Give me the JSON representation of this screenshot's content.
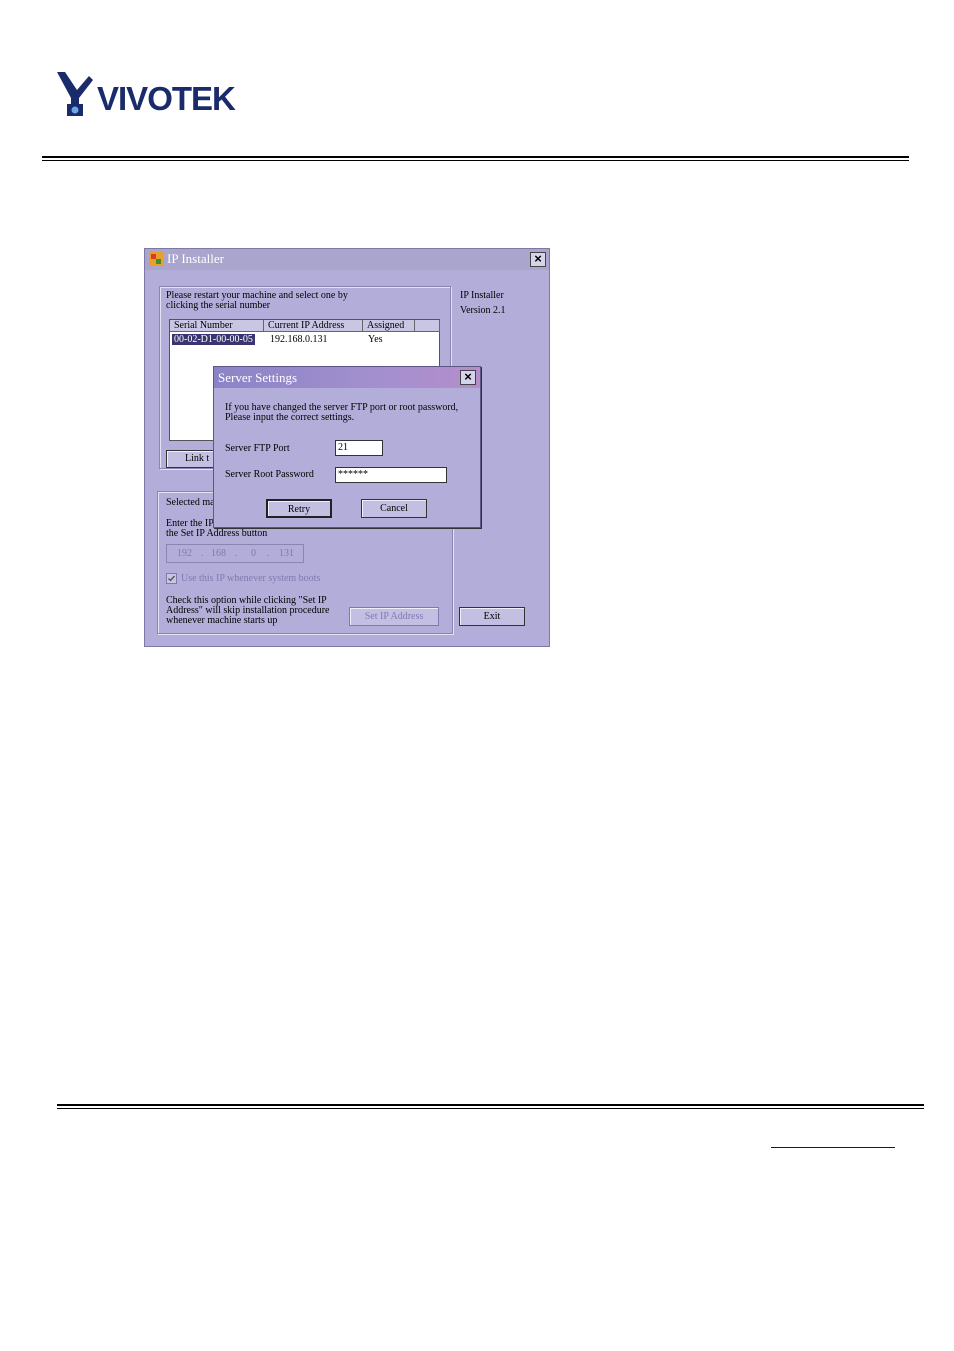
{
  "logo": {
    "brand": "VIVOTEK"
  },
  "colors": {
    "window_bg": "#b3aed9",
    "dialog_title": "#9488c9",
    "brand": "#1a2b6b",
    "link": "#0000ee"
  },
  "installer": {
    "title": "IP Installer",
    "instruction_line1": "Please restart your machine and select one by",
    "instruction_line2": "clicking the serial number",
    "version_label": "IP Installer",
    "version_value": "Version 2.1",
    "columns": [
      "Serial Number",
      "Current IP Address",
      "Assigned"
    ],
    "rows": [
      {
        "serial": "00-02-D1-00-00-05",
        "ip": "192.168.0.131",
        "assigned": "Yes"
      }
    ],
    "link_button": "Link t",
    "selected_label": "Selected ma",
    "enter_ip_line1": "Enter the IP",
    "enter_ip_line2": "the Set IP Address button",
    "ip_octets": [
      "192",
      "168",
      "0",
      "131"
    ],
    "ip_dot": ".",
    "checkbox_label": "Use this IP whenever system boots",
    "note_line1": "Check this option while clicking \"Set IP",
    "note_line2": "Address\" will skip installation procedure",
    "note_line3": "whenever machine starts up",
    "set_ip_button": "Set IP Address",
    "exit_button": "Exit"
  },
  "dialog": {
    "title": "Server Settings",
    "message_line1": "If you have changed the server FTP port or root password,",
    "message_line2": "Please input the correct settings.",
    "ftp_port_label": "Server FTP Port",
    "ftp_port_value": "21",
    "password_label": "Server Root Password",
    "password_value": "******",
    "retry_button": "Retry",
    "cancel_button": "Cancel"
  },
  "close_glyph": "×"
}
